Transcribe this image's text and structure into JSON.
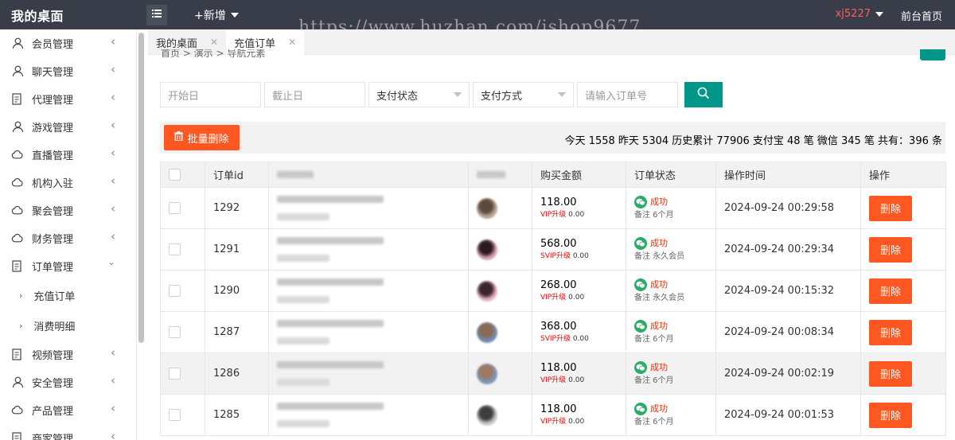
{
  "header": {
    "brand": "我的桌面",
    "add_new": "+新增",
    "watermark": "https://www.huzhan.com/ishop9677",
    "username": "xj5227",
    "front_page": "前台首页"
  },
  "sidebar": {
    "items": [
      {
        "label": "会员管理",
        "icon": "user-icon"
      },
      {
        "label": "聊天管理",
        "icon": "user-icon"
      },
      {
        "label": "代理管理",
        "icon": "document-icon"
      },
      {
        "label": "游戏管理",
        "icon": "user-icon"
      },
      {
        "label": "直播管理",
        "icon": "cloud-icon"
      },
      {
        "label": "机构入驻",
        "icon": "cloud-icon"
      },
      {
        "label": "聚会管理",
        "icon": "cloud-icon"
      },
      {
        "label": "财务管理",
        "icon": "cloud-icon"
      },
      {
        "label": "订单管理",
        "icon": "document-icon"
      }
    ],
    "sub_items": [
      {
        "label": "充值订单"
      },
      {
        "label": "消费明细"
      }
    ],
    "items_after": [
      {
        "label": "视频管理",
        "icon": "document-icon"
      },
      {
        "label": "安全管理",
        "icon": "user-icon"
      },
      {
        "label": "产品管理",
        "icon": "cloud-icon"
      },
      {
        "label": "商家管理",
        "icon": "document-icon"
      }
    ]
  },
  "tabs": [
    {
      "label": "我的桌面"
    },
    {
      "label": "充值订单"
    }
  ],
  "breadcrumb": "首页 > 演示 > 导航元素",
  "filters": {
    "start_date_placeholder": "开始日",
    "end_date_placeholder": "截止日",
    "pay_status": "支付状态",
    "pay_method": "支付方式",
    "order_placeholder": "请输入订单号"
  },
  "actions": {
    "batch_delete": "批量删除",
    "stats": "今天 1558 昨天 5304 历史累计 77906 支付宝 48 笔 微信 345 笔 共有：396 条"
  },
  "table": {
    "headers": [
      "订单id",
      "订单编号",
      "充值id",
      "购买金额",
      "订单状态",
      "操作时间",
      "操作"
    ],
    "delete_label": "删除",
    "rows": [
      {
        "id": "1292",
        "amount": "118.00",
        "upgrade_level": "VIP升级",
        "upgrade_amount": "0.00",
        "status": "成功",
        "note": "备注 6个月",
        "time": "2024-09-24 00:29:58",
        "avatar": [
          "#b8a99a",
          "#5c4a3e"
        ]
      },
      {
        "id": "1291",
        "amount": "568.00",
        "upgrade_level": "SVIP升级",
        "upgrade_amount": "0.00",
        "status": "成功",
        "note": "备注 永久会员",
        "time": "2024-09-24 00:29:34",
        "avatar": [
          "#d9a3b2",
          "#2b1a22"
        ]
      },
      {
        "id": "1290",
        "amount": "268.00",
        "upgrade_level": "VIP升级",
        "upgrade_amount": "0.00",
        "status": "成功",
        "note": "备注 永久会员",
        "time": "2024-09-24 00:15:32",
        "avatar": [
          "#e8b4bf",
          "#3a2430"
        ]
      },
      {
        "id": "1287",
        "amount": "368.00",
        "upgrade_level": "SVIP升级",
        "upgrade_amount": "0.00",
        "status": "成功",
        "note": "备注 6个月",
        "time": "2024-09-24 00:08:34",
        "avatar": [
          "#6f8fb5",
          "#8a6a55"
        ]
      },
      {
        "id": "1286",
        "amount": "118.00",
        "upgrade_level": "VIP升级",
        "upgrade_amount": "0.00",
        "status": "成功",
        "note": "备注 6个月",
        "time": "2024-09-24 00:02:19",
        "avatar": [
          "#7a97c0",
          "#9b7a60"
        ]
      },
      {
        "id": "1285",
        "amount": "118.00",
        "upgrade_level": "VIP升级",
        "upgrade_amount": "0.00",
        "status": "成功",
        "note": "备注 6个月",
        "time": "2024-09-24 00:01:53",
        "avatar": [
          "#c9c9c9",
          "#3d3d3d"
        ]
      }
    ]
  },
  "colors": {
    "topbar": "#393d49",
    "teal": "#009688",
    "danger": "#ff5722",
    "wechat": "#2aae67",
    "username": "#ff5c5c"
  }
}
